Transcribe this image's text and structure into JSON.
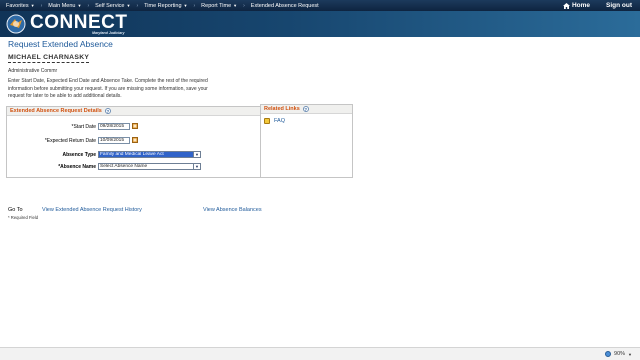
{
  "menu": {
    "items": [
      {
        "label": "Favorites"
      },
      {
        "label": "Main Menu"
      },
      {
        "label": "Self Service"
      },
      {
        "label": "Time Reporting"
      },
      {
        "label": "Report Time"
      },
      {
        "label": "Extended Absence Request"
      }
    ],
    "home_label": "Home",
    "signout_label": "Sign out"
  },
  "banner": {
    "logo_text": "CONNECT",
    "logo_subtext": "Maryland Judiciary"
  },
  "page": {
    "title": "Request Extended Absence",
    "employee_name": "MICHAEL CHARNASKY",
    "employee_title": "Administrative Commr",
    "instructions": "Enter Start Date, Expected End Date and Absence Take. Complete the rest of the required information before submitting your request. If you are missing some information, save your request for later to be able to add additional details."
  },
  "details": {
    "header": "Extended Absence Request Details",
    "start_date_label": "*Start Date",
    "start_date_value": "09/28/2015",
    "return_date_label": "*Expected Return Date",
    "return_date_value": "10/09/2015",
    "absence_type_label": "Absence Type",
    "absence_type_value": "Family and Medical Leave Act",
    "absence_name_label": "*Absence Name",
    "absence_name_value": "Select Absence Name"
  },
  "related_links": {
    "header": "Related Links",
    "faq_label": "FAQ"
  },
  "goto": {
    "label": "Go To",
    "history_link": "View Extended Absence Request History",
    "balances_link": "View Absence Balances"
  },
  "required_note": "* Required Field",
  "status": {
    "zoom": "90%"
  },
  "colors": {
    "menubar": "#0e2440",
    "banner": "#17466f",
    "title": "#1f5a9a",
    "section_header": "#d1510e",
    "selected": "#3063c9"
  }
}
